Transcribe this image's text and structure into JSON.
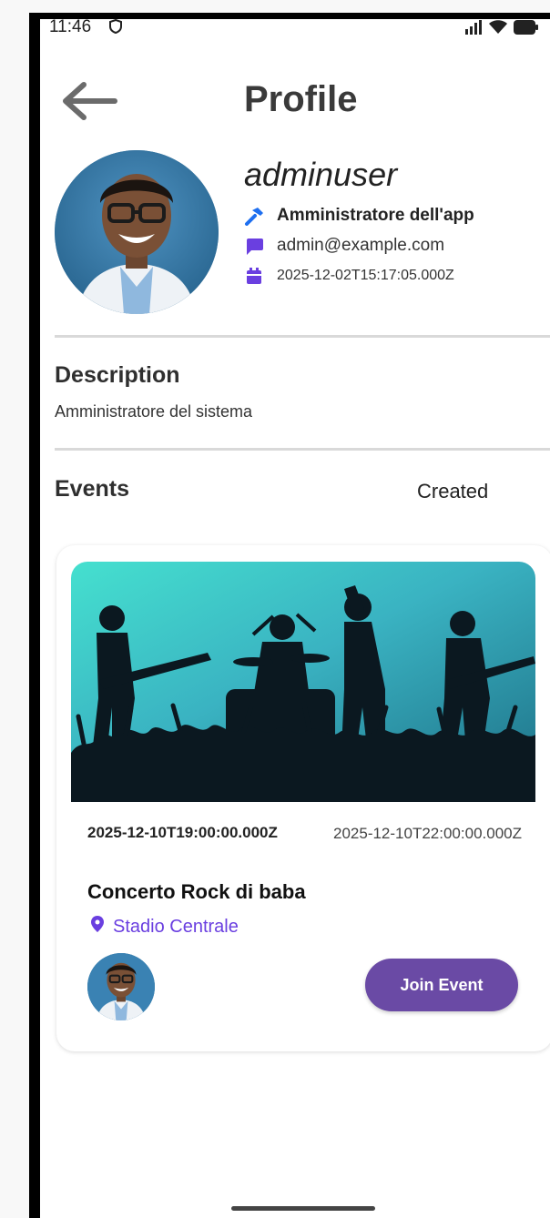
{
  "status_bar": {
    "time": "11:46",
    "vpn_icon": "shield-icon",
    "signal_icon": "signal-icon",
    "wifi_icon": "wifi-icon",
    "battery_icon": "battery-icon"
  },
  "header": {
    "back_icon": "arrow-left-icon",
    "title": "Profile"
  },
  "profile": {
    "avatar": "avatar-photo",
    "username": "adminuser",
    "role": "Amministratore dell'app",
    "email": "admin@example.com",
    "created_at": "2025-12-02T15:17:05.000Z",
    "icons": {
      "role": "hammer-icon",
      "email": "chat-bubble-icon",
      "date": "calendar-icon"
    }
  },
  "description": {
    "title": "Description",
    "text": "Amministratore del sistema"
  },
  "events": {
    "title": "Events",
    "filter_label": "Created",
    "items": [
      {
        "start": "2025-12-10T19:00:00.000Z",
        "end": "2025-12-10T22:00:00.000Z",
        "title": "Concerto Rock di baba",
        "location": "Stadio Centrale",
        "join_label": "Join Event"
      }
    ]
  },
  "colors": {
    "accent": "#6a3fe0",
    "role_icon": "#1e6ff0",
    "join_button": "#6a4aa5"
  }
}
